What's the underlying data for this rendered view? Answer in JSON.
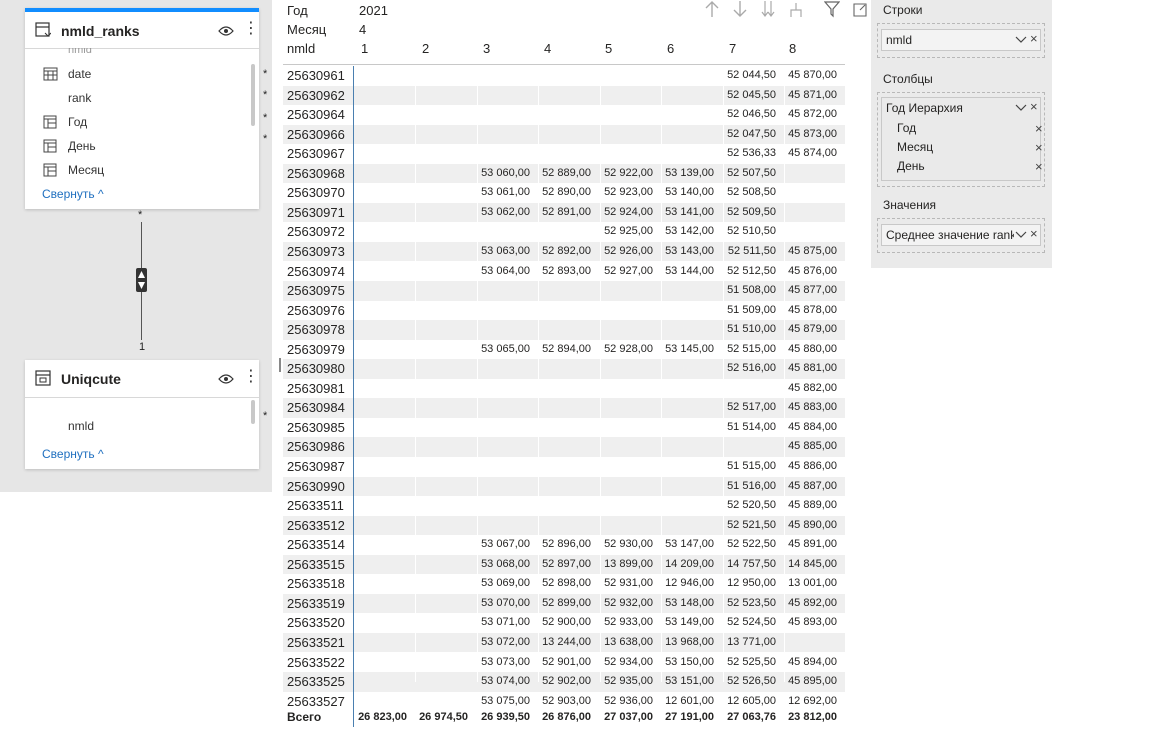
{
  "model": {
    "table1": {
      "title": "nmld_ranks",
      "clipped_field": "nmld",
      "fields": [
        "date",
        "rank",
        "Год",
        "День",
        "Месяц"
      ],
      "field_icons": [
        "calendar-icon",
        "none",
        "hierarchy-table-icon",
        "hierarchy-table-icon",
        "hierarchy-table-icon"
      ],
      "collapse": "Свернуть"
    },
    "table2": {
      "title": "Uniqcute",
      "fields": [
        "nmld"
      ],
      "collapse": "Свернуть"
    },
    "relationship": {
      "many": "*",
      "one": "1"
    }
  },
  "matrix": {
    "filters": [
      {
        "label": "Год",
        "value": "2021"
      },
      {
        "label": "Месяц",
        "value": "4"
      }
    ],
    "row_header": "nmld",
    "columns": [
      "1",
      "2",
      "3",
      "4",
      "5",
      "6",
      "7",
      "8"
    ],
    "rows": [
      {
        "id": "25630961",
        "cells": [
          "",
          "",
          "",
          "",
          "",
          "",
          "52 044,50",
          "45 870,00"
        ]
      },
      {
        "id": "25630962",
        "cells": [
          "",
          "",
          "",
          "",
          "",
          "",
          "52 045,50",
          "45 871,00"
        ]
      },
      {
        "id": "25630964",
        "cells": [
          "",
          "",
          "",
          "",
          "",
          "",
          "52 046,50",
          "45 872,00"
        ]
      },
      {
        "id": "25630966",
        "cells": [
          "",
          "",
          "",
          "",
          "",
          "",
          "52 047,50",
          "45 873,00"
        ]
      },
      {
        "id": "25630967",
        "cells": [
          "",
          "",
          "",
          "",
          "",
          "",
          "52 536,33",
          "45 874,00"
        ]
      },
      {
        "id": "25630968",
        "cells": [
          "",
          "",
          "53 060,00",
          "52 889,00",
          "52 922,00",
          "53 139,00",
          "52 507,50",
          ""
        ]
      },
      {
        "id": "25630970",
        "cells": [
          "",
          "",
          "53 061,00",
          "52 890,00",
          "52 923,00",
          "53 140,00",
          "52 508,50",
          ""
        ]
      },
      {
        "id": "25630971",
        "cells": [
          "",
          "",
          "53 062,00",
          "52 891,00",
          "52 924,00",
          "53 141,00",
          "52 509,50",
          ""
        ]
      },
      {
        "id": "25630972",
        "cells": [
          "",
          "",
          "",
          "",
          "52 925,00",
          "53 142,00",
          "52 510,50",
          ""
        ]
      },
      {
        "id": "25630973",
        "cells": [
          "",
          "",
          "53 063,00",
          "52 892,00",
          "52 926,00",
          "53 143,00",
          "52 511,50",
          "45 875,00"
        ]
      },
      {
        "id": "25630974",
        "cells": [
          "",
          "",
          "53 064,00",
          "52 893,00",
          "52 927,00",
          "53 144,00",
          "52 512,50",
          "45 876,00"
        ]
      },
      {
        "id": "25630975",
        "cells": [
          "",
          "",
          "",
          "",
          "",
          "",
          "51 508,00",
          "45 877,00"
        ]
      },
      {
        "id": "25630976",
        "cells": [
          "",
          "",
          "",
          "",
          "",
          "",
          "51 509,00",
          "45 878,00"
        ]
      },
      {
        "id": "25630978",
        "cells": [
          "",
          "",
          "",
          "",
          "",
          "",
          "51 510,00",
          "45 879,00"
        ]
      },
      {
        "id": "25630979",
        "cells": [
          "",
          "",
          "53 065,00",
          "52 894,00",
          "52 928,00",
          "53 145,00",
          "52 515,00",
          "45 880,00"
        ]
      },
      {
        "id": "25630980",
        "cells": [
          "",
          "",
          "",
          "",
          "",
          "",
          "52 516,00",
          "45 881,00"
        ]
      },
      {
        "id": "25630981",
        "cells": [
          "",
          "",
          "",
          "",
          "",
          "",
          "",
          "45 882,00"
        ]
      },
      {
        "id": "25630984",
        "cells": [
          "",
          "",
          "",
          "",
          "",
          "",
          "52 517,00",
          "45 883,00"
        ]
      },
      {
        "id": "25630985",
        "cells": [
          "",
          "",
          "",
          "",
          "",
          "",
          "51 514,00",
          "45 884,00"
        ]
      },
      {
        "id": "25630986",
        "cells": [
          "",
          "",
          "",
          "",
          "",
          "",
          "",
          "45 885,00"
        ]
      },
      {
        "id": "25630987",
        "cells": [
          "",
          "",
          "",
          "",
          "",
          "",
          "51 515,00",
          "45 886,00"
        ]
      },
      {
        "id": "25630990",
        "cells": [
          "",
          "",
          "",
          "",
          "",
          "",
          "51 516,00",
          "45 887,00"
        ]
      },
      {
        "id": "25633511",
        "cells": [
          "",
          "",
          "",
          "",
          "",
          "",
          "52 520,50",
          "45 889,00"
        ]
      },
      {
        "id": "25633512",
        "cells": [
          "",
          "",
          "",
          "",
          "",
          "",
          "52 521,50",
          "45 890,00"
        ]
      },
      {
        "id": "25633514",
        "cells": [
          "",
          "",
          "53 067,00",
          "52 896,00",
          "52 930,00",
          "53 147,00",
          "52 522,50",
          "45 891,00"
        ]
      },
      {
        "id": "25633515",
        "cells": [
          "",
          "",
          "53 068,00",
          "52 897,00",
          "13 899,00",
          "14 209,00",
          "14 757,50",
          "14 845,00"
        ]
      },
      {
        "id": "25633518",
        "cells": [
          "",
          "",
          "53 069,00",
          "52 898,00",
          "52 931,00",
          "12 946,00",
          "12 950,00",
          "13 001,00"
        ]
      },
      {
        "id": "25633519",
        "cells": [
          "",
          "",
          "53 070,00",
          "52 899,00",
          "52 932,00",
          "53 148,00",
          "52 523,50",
          "45 892,00"
        ]
      },
      {
        "id": "25633520",
        "cells": [
          "",
          "",
          "53 071,00",
          "52 900,00",
          "52 933,00",
          "53 149,00",
          "52 524,50",
          "45 893,00"
        ]
      },
      {
        "id": "25633521",
        "cells": [
          "",
          "",
          "53 072,00",
          "13 244,00",
          "13 638,00",
          "13 968,00",
          "13 771,00",
          ""
        ]
      },
      {
        "id": "25633522",
        "cells": [
          "",
          "",
          "53 073,00",
          "52 901,00",
          "52 934,00",
          "53 150,00",
          "52 525,50",
          "45 894,00"
        ]
      },
      {
        "id": "25633525",
        "cells": [
          "",
          "",
          "53 074,00",
          "52 902,00",
          "52 935,00",
          "53 151,00",
          "52 526,50",
          "45 895,00"
        ]
      },
      {
        "id": "25633527",
        "cells": [
          "",
          "",
          "53 075,00",
          "52 903,00",
          "52 936,00",
          "12 601,00",
          "12 605,00",
          "12 692,00"
        ]
      }
    ],
    "total": {
      "label": "Всего",
      "cells": [
        "26 823,00",
        "26 974,50",
        "26 939,50",
        "26 876,00",
        "27 037,00",
        "27 191,00",
        "27 063,76",
        "23 812,00"
      ]
    }
  },
  "wells": {
    "rows_title": "Строки",
    "rows_field": "nmld",
    "columns_title": "Столбцы",
    "columns_field": "Год Иерархия",
    "columns_levels": [
      "Год",
      "Месяц",
      "День"
    ],
    "values_title": "Значения",
    "values_field": "Среднее значение rank"
  }
}
